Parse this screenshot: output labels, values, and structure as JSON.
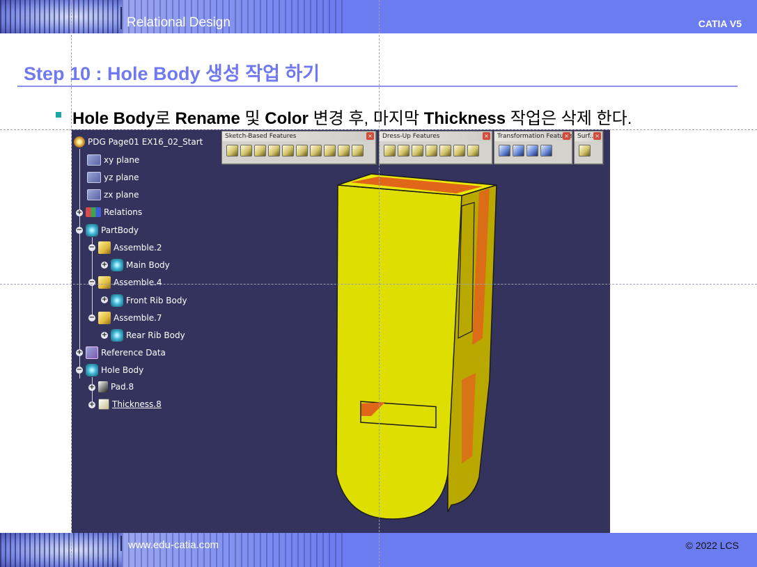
{
  "header": {
    "left_title": "Relational Design",
    "right_title": "CATIA V5"
  },
  "slide": {
    "step_title": "Step 10 : Hole Body 생성 작업 하기",
    "bullet": {
      "part1": "Hole Body",
      "part2": "로 ",
      "part3": "Rename",
      "part4": " 및 ",
      "part5": "Color",
      "part6": " 변경 후, 마지막 ",
      "part7": "Thickness",
      "part8": " 작업은 삭제 한다."
    }
  },
  "toolbars": [
    {
      "title": "Sketch-Based Features",
      "buttons": 10
    },
    {
      "title": "Dress-Up Features",
      "buttons": 7
    },
    {
      "title": "Transformation Features",
      "buttons": 4
    },
    {
      "title": "Surf...",
      "buttons": 1
    }
  ],
  "tree": {
    "root": "PDG Page01 EX16_02_Start",
    "xy": "xy plane",
    "yz": "yz plane",
    "zx": "zx plane",
    "relations": "Relations",
    "partbody": "PartBody",
    "asm2": "Assemble.2",
    "mainbody": "Main Body",
    "asm4": "Assemble.4",
    "frontrib": "Front Rib Body",
    "asm7": "Assemble.7",
    "rearrib": "Rear Rib Body",
    "refdata": "Reference Data",
    "holebody": "Hole Body",
    "pad8": "Pad.8",
    "thick8": "Thickness.8"
  },
  "colors": {
    "banner": "#6b7cf0",
    "title": "#7079f0",
    "viewport_bg": "#34335e",
    "part_yellow": "#dede00",
    "part_orange": "#e0661a"
  },
  "footer": {
    "url": "www.edu-catia.com",
    "copyright": "© 2022 LCS"
  }
}
